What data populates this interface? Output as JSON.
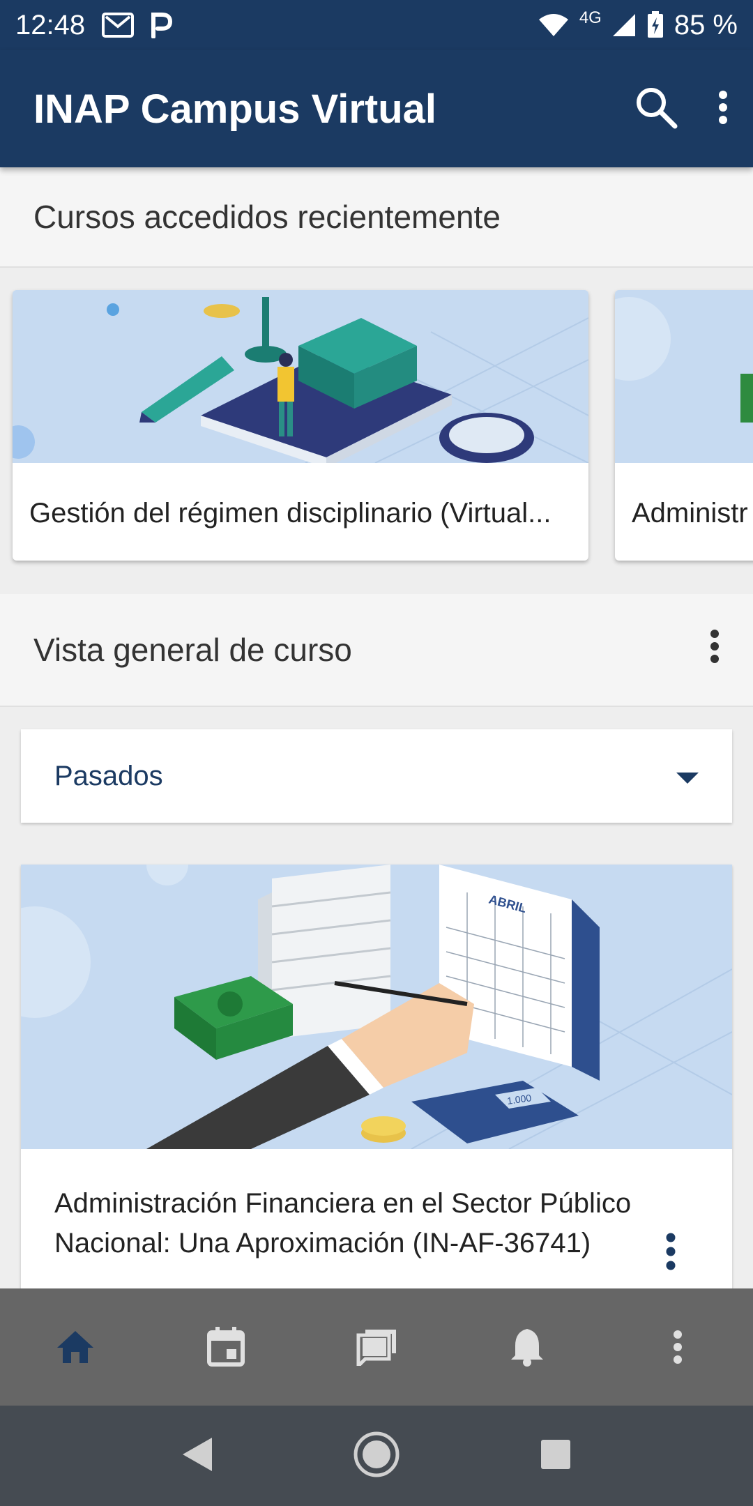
{
  "status": {
    "time": "12:48",
    "network": "4G",
    "battery": "85 %",
    "icons": [
      "gmail-icon",
      "parking-icon",
      "wifi-icon",
      "signal-icon",
      "battery-icon"
    ]
  },
  "appbar": {
    "title": "INAP Campus Virtual",
    "actions": [
      "search-icon",
      "overflow-menu-icon"
    ]
  },
  "recent": {
    "header": "Cursos accedidos recientemente",
    "cards": [
      {
        "name": "Gestión del régimen disciplinario (Virtual..."
      },
      {
        "name": "Administr"
      }
    ]
  },
  "overview": {
    "header": "Vista general de curso",
    "filter": {
      "selected": "Pasados"
    }
  },
  "course": {
    "name": "Administración Financiera en el Sector Público Nacional: Una Aproximación (IN-AF-36741)",
    "image_text": {
      "month": "ABRIL",
      "display": "1.000"
    }
  },
  "tabs": [
    "home-icon",
    "calendar-icon",
    "messages-icon",
    "notifications-icon",
    "more-icon"
  ],
  "nav": [
    "back-icon",
    "home-circle-icon",
    "recents-icon"
  ],
  "colors": {
    "primary": "#1b3a62",
    "tabbar": "#666666",
    "navbar": "#454b52"
  }
}
